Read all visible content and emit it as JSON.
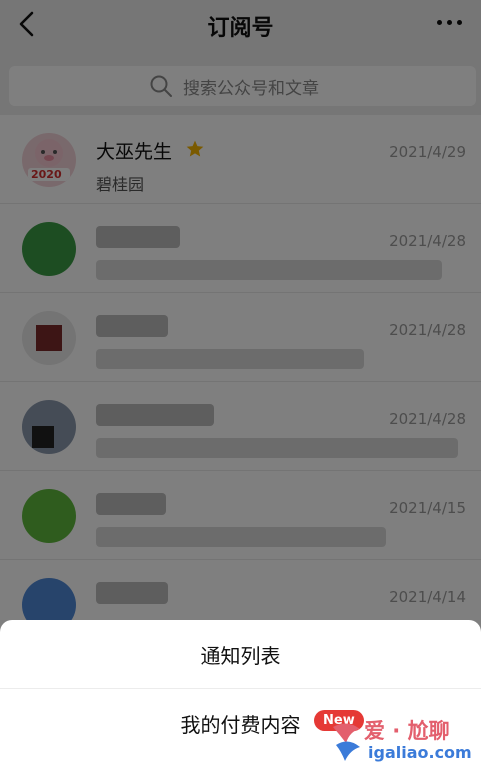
{
  "header": {
    "title": "订阅号",
    "back_icon": "chevron-left-icon",
    "more_icon": "more-dots-icon"
  },
  "search": {
    "placeholder": "搜索公众号和文章",
    "icon": "search-icon"
  },
  "list": [
    {
      "name": "大巫先生",
      "subtitle": "碧桂园",
      "date": "2021/4/29",
      "starred": true,
      "avatar_year": "2020"
    },
    {
      "name": "",
      "subtitle": "",
      "date": "2021/4/28"
    },
    {
      "name": "",
      "subtitle": "",
      "date": "2021/4/28"
    },
    {
      "name": "",
      "subtitle": "",
      "date": "2021/4/28"
    },
    {
      "name": "",
      "subtitle": "",
      "date": "2021/4/15"
    },
    {
      "name": "",
      "subtitle": "",
      "date": "2021/4/14"
    }
  ],
  "sheet": {
    "item1": "通知列表",
    "item2": "我的付费内容",
    "badge": "New"
  },
  "watermark": {
    "text": "爱 · 尬聊",
    "url": "igaliao.com"
  },
  "colors": {
    "overlay": "rgba(0,0,0,0.5)",
    "badge": "#e53935",
    "star": "#f5b400"
  }
}
